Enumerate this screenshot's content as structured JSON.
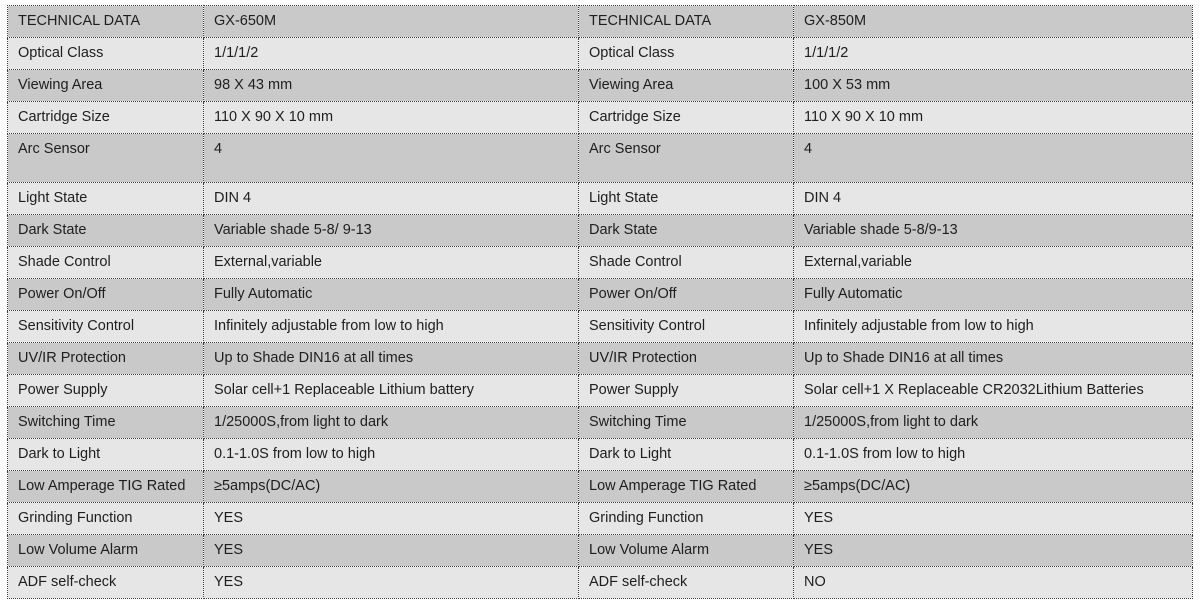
{
  "table": {
    "header": {
      "label_left": "TECHNICAL DATA",
      "model_left": "GX-650M",
      "label_right": "TECHNICAL DATA",
      "model_right": "GX-850M"
    },
    "rows": [
      {
        "label_left": "Optical Class",
        "value_left": "1/1/1/2",
        "label_right": "Optical Class",
        "value_right": "1/1/1/2"
      },
      {
        "label_left": "Viewing Area",
        "value_left": "98 X 43 mm",
        "label_right": "Viewing Area",
        "value_right": "100 X 53 mm"
      },
      {
        "label_left": "Cartridge Size",
        "value_left": "110 X 90 X 10 mm",
        "label_right": "Cartridge Size",
        "value_right": "110 X 90 X 10 mm"
      },
      {
        "label_left": "Arc Sensor",
        "value_left": "4",
        "label_right": "Arc Sensor",
        "value_right": "4"
      },
      {
        "label_left": "Light State",
        "value_left": "DIN 4",
        "label_right": "Light State",
        "value_right": "DIN 4"
      },
      {
        "label_left": "Dark State",
        "value_left": "Variable shade 5-8/ 9-13",
        "label_right": "Dark State",
        "value_right": "Variable shade 5-8/9-13"
      },
      {
        "label_left": "Shade Control",
        "value_left": "External,variable",
        "label_right": "Shade Control",
        "value_right": "External,variable"
      },
      {
        "label_left": "Power On/Off",
        "value_left": "Fully Automatic",
        "label_right": "Power On/Off",
        "value_right": "Fully Automatic"
      },
      {
        "label_left": "Sensitivity Control",
        "value_left": "Infinitely adjustable from low to high",
        "label_right": "Sensitivity Control",
        "value_right": "Infinitely adjustable from low to high"
      },
      {
        "label_left": "UV/IR Protection",
        "value_left": "Up to Shade DIN16 at all times",
        "label_right": "UV/IR Protection",
        "value_right": "Up to Shade DIN16 at all times"
      },
      {
        "label_left": "Power Supply",
        "value_left": "Solar cell+1 Replaceable Lithium battery",
        "label_right": "Power Supply",
        "value_right": "Solar cell+1 X Replaceable CR2032Lithium Batteries"
      },
      {
        "label_left": "Switching Time",
        "value_left": "1/25000S,from light to dark",
        "label_right": "Switching Time",
        "value_right": "1/25000S,from light to dark"
      },
      {
        "label_left": "Dark to Light",
        "value_left": "0.1-1.0S from low to high",
        "label_right": "Dark to Light",
        "value_right": "0.1-1.0S from low to high"
      },
      {
        "label_left": "Low Amperage TIG Rated",
        "value_left": "≥5amps(DC/AC)",
        "label_right": "Low Amperage TIG Rated",
        "value_right": "≥5amps(DC/AC)"
      },
      {
        "label_left": "Grinding Function",
        "value_left": "YES",
        "label_right": "Grinding Function",
        "value_right": "YES"
      },
      {
        "label_left": "Low Volume Alarm",
        "value_left": "YES",
        "label_right": "Low Volume Alarm",
        "value_right": "YES"
      },
      {
        "label_left": "ADF self-check",
        "value_left": "YES",
        "label_right": "ADF self-check",
        "value_right": "NO"
      }
    ]
  },
  "colors": {
    "row_dark": "#c9c9c9",
    "row_light": "#e6e6e6",
    "text": "#1e1e1e"
  }
}
